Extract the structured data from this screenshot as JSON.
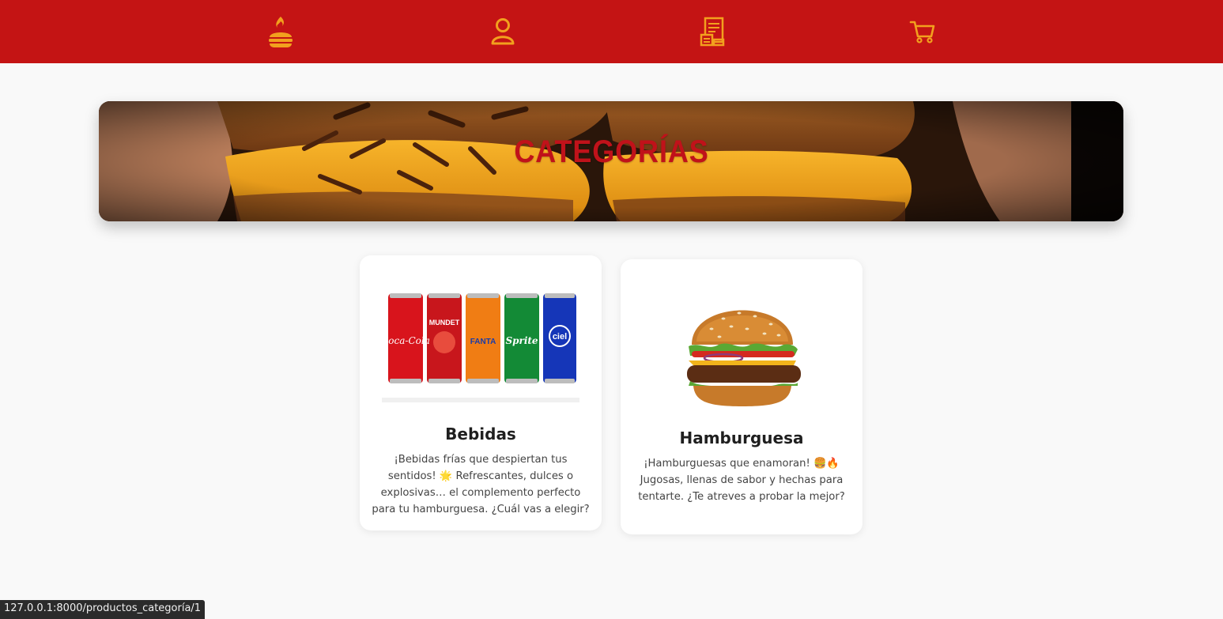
{
  "nav": {
    "items": [
      {
        "icon": "burger-flame-icon"
      },
      {
        "icon": "user-icon"
      },
      {
        "icon": "receipt-icon"
      },
      {
        "icon": "cart-icon"
      }
    ],
    "accent": "#f2a01e",
    "background": "#c41414"
  },
  "banner": {
    "title": "CATEGORÍAS"
  },
  "categories": [
    {
      "name": "Bebidas",
      "description": "¡Bebidas frías que despiertan tus sentidos! 🌟 Refrescantes, dulces o explosivas… el complemento perfecto para tu hamburguesa. ¿Cuál vas a elegir?",
      "cans": [
        {
          "label": "Coca-Cola",
          "color": "#d8141c"
        },
        {
          "label": "MUNDET",
          "color": "#c8161c"
        },
        {
          "label": "FANTA",
          "color": "#f07d14"
        },
        {
          "label": "Sprite",
          "color": "#138a36"
        },
        {
          "label": "ciel",
          "color": "#1536b8"
        }
      ]
    },
    {
      "name": "Hamburguesa",
      "description": "¡Hamburguesas que enamoran! 🍔🔥 Jugosas, llenas de sabor y hechas para tentarte. ¿Te atreves a probar la mejor?"
    }
  ],
  "status_bar": {
    "url": "127.0.0.1:8000/productos_categoría/1"
  }
}
